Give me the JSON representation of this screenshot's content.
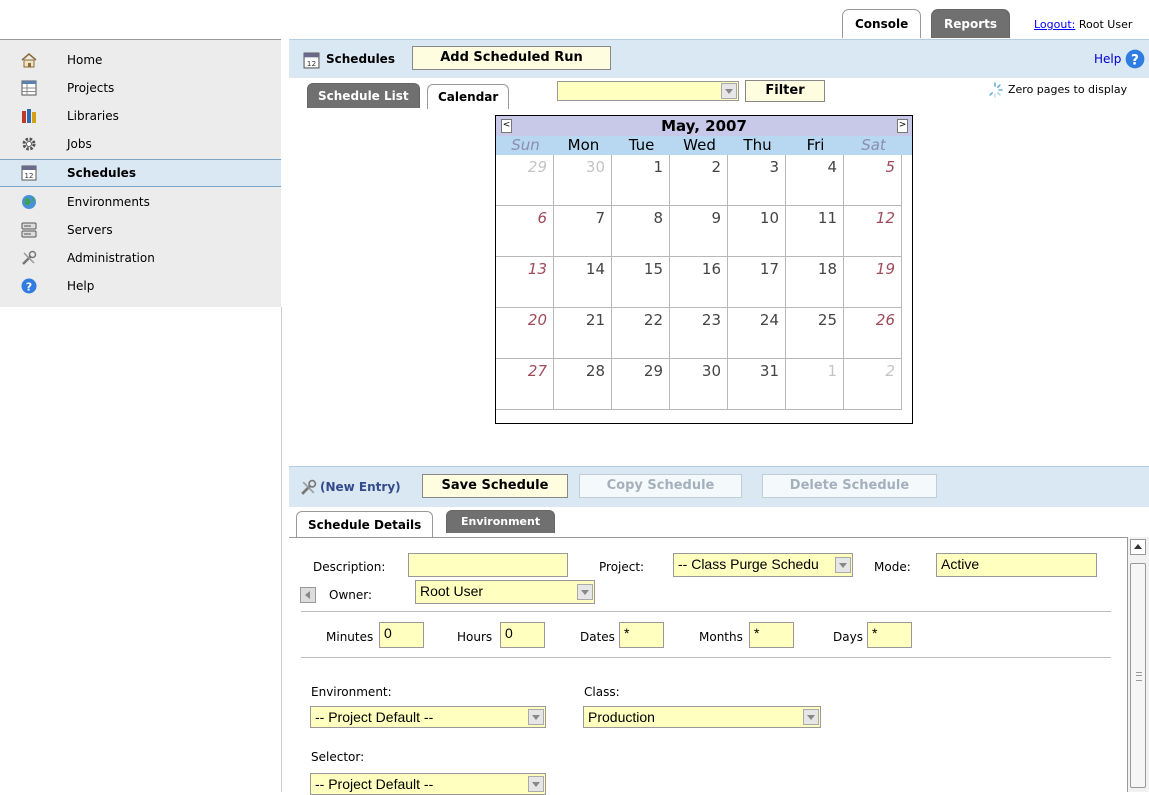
{
  "top_tabs": {
    "console": "Console",
    "reports": "Reports"
  },
  "logout": {
    "link": "Logout:",
    "user": "Root User"
  },
  "sidebar": {
    "items": [
      {
        "label": "Home",
        "icon": "home-icon"
      },
      {
        "label": "Projects",
        "icon": "projects-icon"
      },
      {
        "label": "Libraries",
        "icon": "libraries-icon"
      },
      {
        "label": "Jobs",
        "icon": "gear-icon"
      },
      {
        "label": "Schedules",
        "icon": "calendar-icon",
        "active": true
      },
      {
        "label": "Environments",
        "icon": "globe-icon"
      },
      {
        "label": "Servers",
        "icon": "server-icon"
      },
      {
        "label": "Administration",
        "icon": "tools-icon"
      },
      {
        "label": "Help",
        "icon": "help-icon"
      }
    ]
  },
  "toolbar": {
    "section": "Schedules",
    "add_button": "Add Scheduled Run",
    "help": "Help"
  },
  "view_tabs": {
    "list": "Schedule List",
    "calendar": "Calendar"
  },
  "filter": {
    "value": "",
    "button": "Filter"
  },
  "status": "Zero pages to display",
  "calendar": {
    "title": "May, 2007",
    "prev": "<",
    "next": ">",
    "days_of_week": [
      "Sun",
      "Mon",
      "Tue",
      "Wed",
      "Thu",
      "Fri",
      "Sat"
    ],
    "weeks": [
      [
        "29",
        "30",
        "1",
        "2",
        "3",
        "4",
        "5"
      ],
      [
        "6",
        "7",
        "8",
        "9",
        "10",
        "11",
        "12"
      ],
      [
        "13",
        "14",
        "15",
        "16",
        "17",
        "18",
        "19"
      ],
      [
        "20",
        "21",
        "22",
        "23",
        "24",
        "25",
        "26"
      ],
      [
        "27",
        "28",
        "29",
        "30",
        "31",
        "1",
        "2"
      ]
    ]
  },
  "editor": {
    "entry": "(New Entry)",
    "save": "Save Schedule",
    "copy": "Copy Schedule",
    "delete": "Delete Schedule",
    "tabs": {
      "details": "Schedule Details",
      "environment": "Environment"
    },
    "fields": {
      "description_label": "Description:",
      "description_value": "",
      "project_label": "Project:",
      "project_value": "-- Class Purge Schedu",
      "mode_label": "Mode:",
      "mode_value": "Active",
      "owner_label": "Owner:",
      "owner_value": "Root User",
      "minutes_label": "Minutes",
      "minutes_value": "0",
      "hours_label": "Hours",
      "hours_value": "0",
      "dates_label": "Dates",
      "dates_value": "*",
      "months_label": "Months",
      "months_value": "*",
      "days_label": "Days",
      "days_value": "*",
      "environment_label": "Environment:",
      "environment_value": "-- Project Default --",
      "class_label": "Class:",
      "class_value": "Production",
      "selector_label": "Selector:",
      "selector_value": "-- Project Default --"
    }
  },
  "colors": {
    "toolbar_bg": "#d9e8f3",
    "field_bg": "#ffffc0",
    "button_bg": "#fffde0",
    "tab_dark": "#707070",
    "calendar_header": "#c8c8e8",
    "calendar_dow": "#b8d8f2",
    "weekend_text": "#9e4b5a"
  }
}
